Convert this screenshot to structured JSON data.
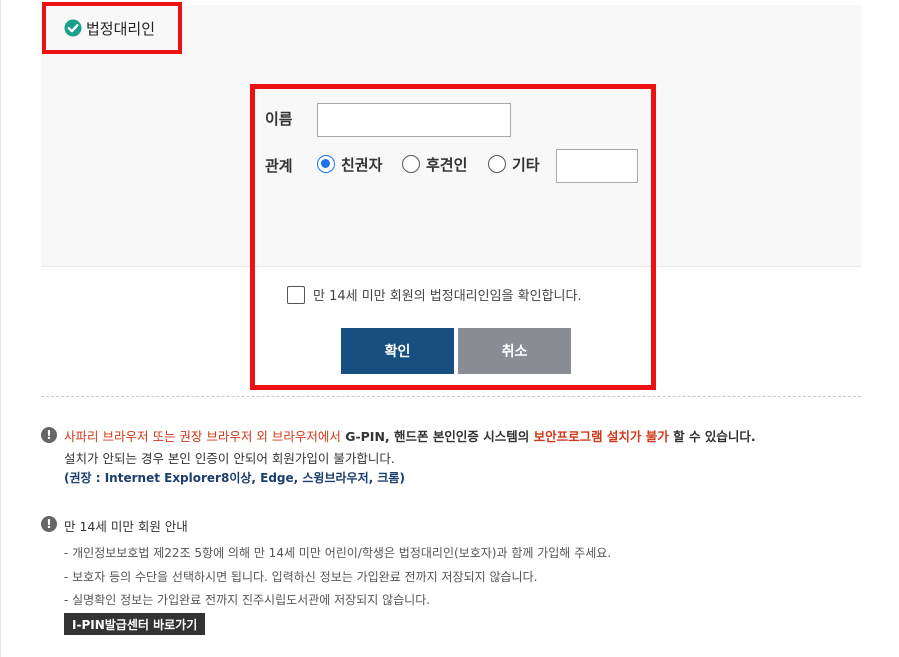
{
  "section": {
    "title": "법정대리인",
    "check_icon": "check-circle-icon",
    "accent_color": "#1aa08a"
  },
  "form": {
    "name_label": "이름",
    "name_value": "",
    "relation_label": "관계",
    "relations": [
      {
        "label": "친권자",
        "selected": true
      },
      {
        "label": "후견인",
        "selected": false
      },
      {
        "label": "기타",
        "selected": false
      }
    ],
    "other_value": "",
    "agree_text": "만 14세 미만 회원의 법정대리인임을 확인합니다.",
    "agree_checked": false,
    "confirm_label": "확인",
    "cancel_label": "취소"
  },
  "notice": {
    "icon": "info-icon",
    "line1_red1": "사파리 브라우저 또는 권장 브라우저 외 브라우저에서",
    "line1_mid": " G-PIN, 핸드폰 본인인증 시스템의 ",
    "line1_red2": "보안프로그램 설치가 불가",
    "line1_end": " 할 수 있습니다.",
    "line2": "설치가 안되는 경우 본인 인증이 안되어 회원가입이 불가합니다.",
    "line3": "(권장 : Internet Explorer8이상, Edge, 스윙브라우저, 크롬)"
  },
  "under14": {
    "title": "만 14세 미만 회원 안내",
    "bullets": [
      "- 개인정보보호법 제22조 5항에 의해 만 14세 미만 어린이/학생은 법정대리인(보호자)과 함께 가입해 주세요.",
      "- 보호자 등의 수단을 선택하시면 됩니다. 입력하신 정보는 가입완료 전까지 저장되지 않습니다.",
      "- 실명확인 정보는 가입완료 전까지 진주시립도서관에 저장되지 않습니다."
    ],
    "ipin_button": "I-PIN발급센터 바로가기"
  },
  "colors": {
    "highlight_border": "#ee1111",
    "confirm_bg": "#184f82",
    "cancel_bg": "#8a8e94",
    "warn_text": "#d03a1a"
  }
}
